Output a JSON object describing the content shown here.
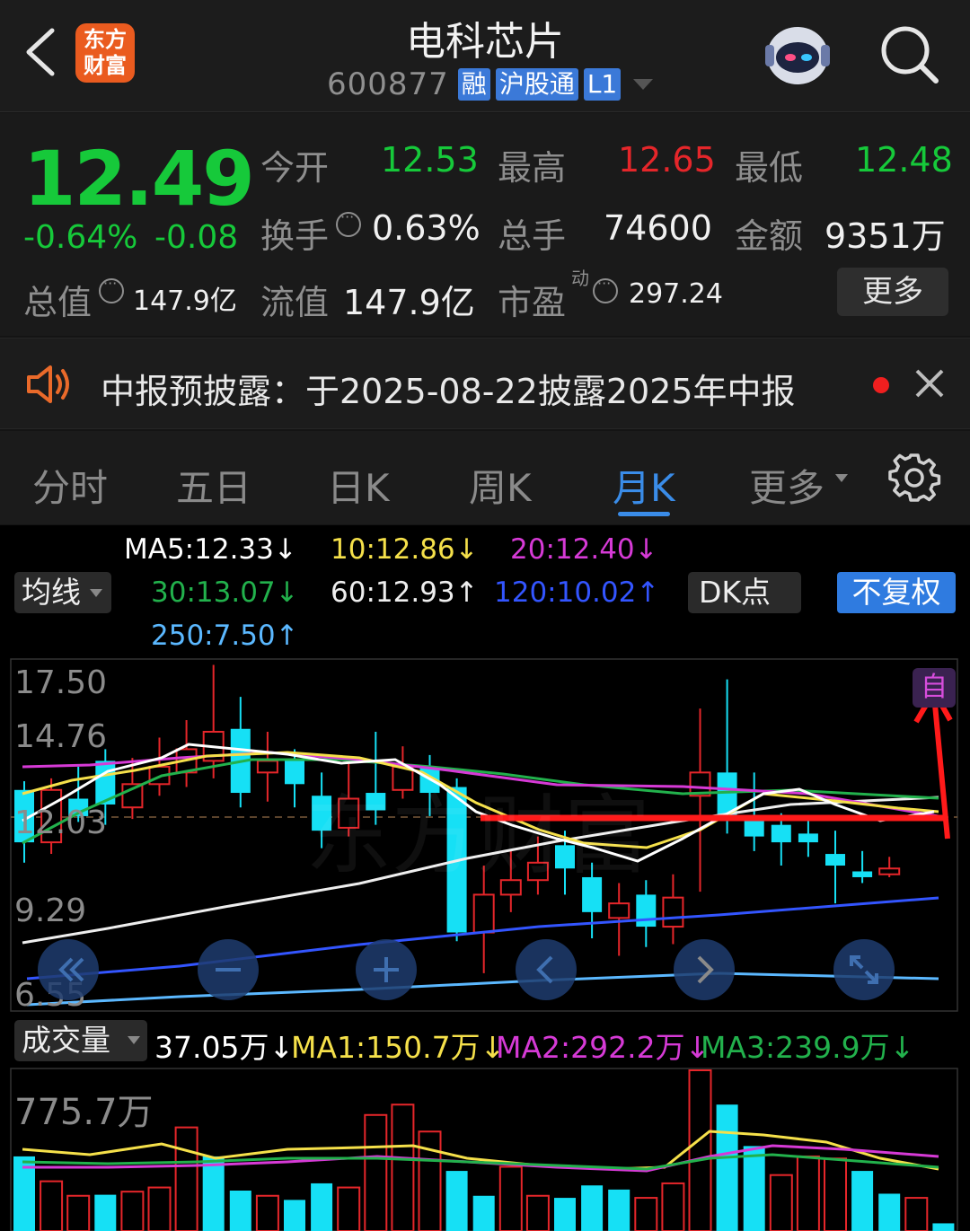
{
  "header": {
    "title": "电科芯片",
    "code": "600877",
    "tags": [
      "融",
      "沪股通",
      "L1"
    ],
    "logo_line1": "东方",
    "logo_line2": "财富"
  },
  "quote": {
    "price": "12.49",
    "change_pct": "-0.64%",
    "change": "-0.08",
    "open_label": "今开",
    "open": "12.53",
    "high_label": "最高",
    "high": "12.65",
    "low_label": "最低",
    "low": "12.48",
    "turnover_label": "换手",
    "turnover": "0.63%",
    "volume_label": "总手",
    "volume": "74600",
    "amount_label": "金额",
    "amount": "9351万",
    "mktcap_label": "总值",
    "mktcap": "147.9亿",
    "float_label": "流值",
    "float": "147.9亿",
    "pe_label": "市盈",
    "pe_sup": "动",
    "pe": "297.24",
    "more_label": "更多"
  },
  "notice": {
    "text": "中报预披露：于2025-08-22披露2025年中报"
  },
  "tabs": {
    "items": [
      "分时",
      "五日",
      "日K",
      "周K",
      "月K",
      "更多"
    ],
    "active": "月K"
  },
  "kline": {
    "ma_button": "均线",
    "dk_button": "DK点",
    "fq_button": "不复权",
    "ma5": "MA5:12.33↓",
    "ma10": "10:12.86↓",
    "ma20": "20:12.40↓",
    "ma30": "30:13.07↓",
    "ma60": "60:12.93↑",
    "ma120": "120:10.02↑",
    "ma250": "250:7.50↑",
    "y_labels": [
      "17.50",
      "14.76",
      "12.03",
      "9.29",
      "6.55"
    ],
    "corner_tag": "自",
    "watermark": "东方财富",
    "colors": {
      "up": "#e5262a",
      "down": "#16e0f5",
      "ma5": "#ffffff",
      "ma10": "#f5e04a",
      "ma20": "#d63ad6",
      "ma30": "#22b14c",
      "ma60": "#eeeeee",
      "ma120": "#3355ff",
      "ma250": "#5bb8ff"
    }
  },
  "volume": {
    "label": "成交量",
    "value": "37.05万↓",
    "ma1": "MA1:150.7万↓",
    "ma2": "MA2:292.2万↓",
    "ma3": "MA3:239.9万↓",
    "y_top": "775.7万"
  },
  "chart_data": {
    "type": "candlestick",
    "period": "monthly",
    "y_ticks": [
      17.5,
      14.76,
      12.03,
      9.29,
      6.55
    ],
    "candles": [
      {
        "o": 13.8,
        "c": 12.0,
        "h": 14.1,
        "l": 11.3,
        "dir": "down"
      },
      {
        "o": 12.0,
        "c": 13.8,
        "h": 14.2,
        "l": 11.6,
        "dir": "up"
      },
      {
        "o": 13.5,
        "c": 12.9,
        "h": 14.6,
        "l": 12.7,
        "dir": "down"
      },
      {
        "o": 14.8,
        "c": 13.3,
        "h": 15.2,
        "l": 12.6,
        "dir": "down"
      },
      {
        "o": 13.2,
        "c": 14.0,
        "h": 14.9,
        "l": 12.8,
        "dir": "up"
      },
      {
        "o": 14.0,
        "c": 14.6,
        "h": 15.6,
        "l": 13.6,
        "dir": "up"
      },
      {
        "o": 14.4,
        "c": 15.2,
        "h": 16.2,
        "l": 13.9,
        "dir": "up"
      },
      {
        "o": 14.8,
        "c": 15.8,
        "h": 18.1,
        "l": 14.2,
        "dir": "up"
      },
      {
        "o": 15.9,
        "c": 13.7,
        "h": 17.0,
        "l": 13.2,
        "dir": "down"
      },
      {
        "o": 14.4,
        "c": 14.8,
        "h": 15.8,
        "l": 13.4,
        "dir": "up"
      },
      {
        "o": 14.8,
        "c": 14.0,
        "h": 15.2,
        "l": 13.2,
        "dir": "down"
      },
      {
        "o": 13.6,
        "c": 12.4,
        "h": 14.4,
        "l": 11.8,
        "dir": "down"
      },
      {
        "o": 12.5,
        "c": 13.5,
        "h": 14.7,
        "l": 12.2,
        "dir": "up"
      },
      {
        "o": 13.7,
        "c": 13.1,
        "h": 15.8,
        "l": 12.6,
        "dir": "down"
      },
      {
        "o": 13.8,
        "c": 14.6,
        "h": 15.3,
        "l": 13.5,
        "dir": "up"
      },
      {
        "o": 14.6,
        "c": 13.7,
        "h": 15.0,
        "l": 12.9,
        "dir": "down"
      },
      {
        "o": 13.9,
        "c": 8.9,
        "h": 14.2,
        "l": 8.6,
        "dir": "down"
      },
      {
        "o": 8.9,
        "c": 10.2,
        "h": 11.2,
        "l": 7.5,
        "dir": "up"
      },
      {
        "o": 10.2,
        "c": 10.7,
        "h": 11.7,
        "l": 9.6,
        "dir": "up"
      },
      {
        "o": 10.7,
        "c": 11.3,
        "h": 12.2,
        "l": 10.2,
        "dir": "up"
      },
      {
        "o": 11.9,
        "c": 11.1,
        "h": 12.4,
        "l": 10.2,
        "dir": "down"
      },
      {
        "o": 10.8,
        "c": 9.6,
        "h": 11.3,
        "l": 8.7,
        "dir": "down"
      },
      {
        "o": 9.4,
        "c": 9.9,
        "h": 10.6,
        "l": 8.1,
        "dir": "up"
      },
      {
        "o": 10.2,
        "c": 9.1,
        "h": 10.7,
        "l": 8.4,
        "dir": "down"
      },
      {
        "o": 9.1,
        "c": 10.1,
        "h": 10.9,
        "l": 8.5,
        "dir": "up"
      },
      {
        "o": 13.6,
        "c": 14.4,
        "h": 16.6,
        "l": 10.3,
        "dir": "up"
      },
      {
        "o": 14.4,
        "c": 12.8,
        "h": 17.6,
        "l": 12.3,
        "dir": "down"
      },
      {
        "o": 12.8,
        "c": 12.2,
        "h": 14.4,
        "l": 11.7,
        "dir": "down"
      },
      {
        "o": 12.6,
        "c": 12.0,
        "h": 13.0,
        "l": 11.2,
        "dir": "down"
      },
      {
        "o": 12.3,
        "c": 12.0,
        "h": 12.9,
        "l": 11.5,
        "dir": "down"
      },
      {
        "o": 11.6,
        "c": 11.2,
        "h": 12.4,
        "l": 9.9,
        "dir": "down"
      },
      {
        "o": 11.0,
        "c": 10.8,
        "h": 11.7,
        "l": 10.6,
        "dir": "down"
      },
      {
        "o": 10.9,
        "c": 11.1,
        "h": 11.5,
        "l": 10.8,
        "dir": "up"
      }
    ],
    "volume_bars": [
      {
        "v": 360,
        "dir": "down"
      },
      {
        "v": 240,
        "dir": "up"
      },
      {
        "v": 170,
        "dir": "up"
      },
      {
        "v": 175,
        "dir": "down"
      },
      {
        "v": 190,
        "dir": "up"
      },
      {
        "v": 210,
        "dir": "up"
      },
      {
        "v": 500,
        "dir": "up"
      },
      {
        "v": 360,
        "dir": "down"
      },
      {
        "v": 195,
        "dir": "down"
      },
      {
        "v": 170,
        "dir": "up"
      },
      {
        "v": 150,
        "dir": "down"
      },
      {
        "v": 230,
        "dir": "down"
      },
      {
        "v": 210,
        "dir": "up"
      },
      {
        "v": 560,
        "dir": "up"
      },
      {
        "v": 610,
        "dir": "up"
      },
      {
        "v": 480,
        "dir": "up"
      },
      {
        "v": 290,
        "dir": "down"
      },
      {
        "v": 170,
        "dir": "down"
      },
      {
        "v": 310,
        "dir": "up"
      },
      {
        "v": 170,
        "dir": "up"
      },
      {
        "v": 160,
        "dir": "down"
      },
      {
        "v": 220,
        "dir": "down"
      },
      {
        "v": 200,
        "dir": "down"
      },
      {
        "v": 160,
        "dir": "up"
      },
      {
        "v": 230,
        "dir": "up"
      },
      {
        "v": 775.7,
        "dir": "up"
      },
      {
        "v": 610,
        "dir": "down"
      },
      {
        "v": 410,
        "dir": "down"
      },
      {
        "v": 270,
        "dir": "up"
      },
      {
        "v": 360,
        "dir": "up"
      },
      {
        "v": 350,
        "dir": "up"
      },
      {
        "v": 290,
        "dir": "down"
      },
      {
        "v": 180,
        "dir": "down"
      },
      {
        "v": 160,
        "dir": "up"
      },
      {
        "v": 37.05,
        "dir": "down"
      }
    ]
  }
}
